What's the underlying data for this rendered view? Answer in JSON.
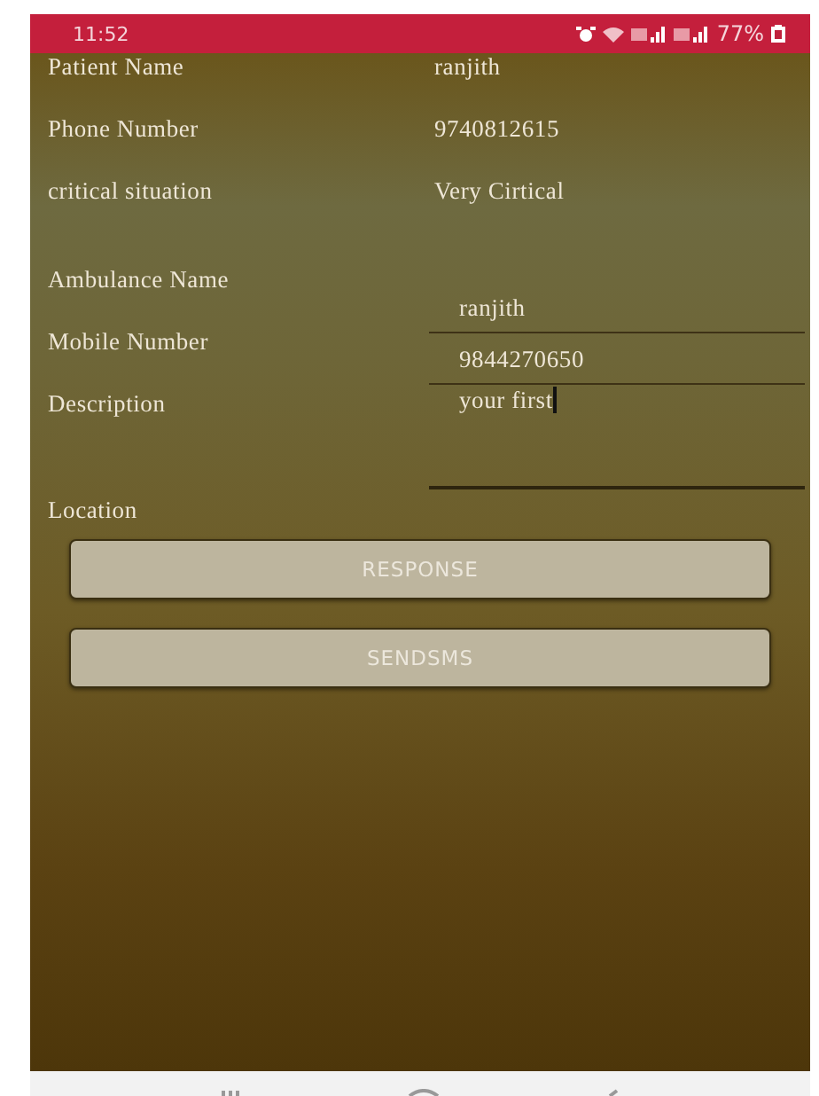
{
  "status_bar": {
    "time": "11:52",
    "battery": "77%"
  },
  "rows": [
    {
      "kind": "text",
      "label": "Patient  Name",
      "value": "ranjith"
    },
    {
      "kind": "text",
      "label": "Phone Number",
      "value": "9740812615"
    },
    {
      "kind": "text",
      "label": "critical situation",
      "value": "Very Cirtical"
    },
    {
      "kind": "field",
      "label": "Ambulance  Name",
      "value": "ranjith",
      "focused": false
    },
    {
      "kind": "field",
      "label": "Mobile Number",
      "value": "9844270650",
      "focused": false
    },
    {
      "kind": "area",
      "label": "Description",
      "value": "your first",
      "focused": true
    },
    {
      "kind": "label",
      "label": "Location"
    }
  ],
  "buttons": [
    "RESPONSE",
    "SENDSMS"
  ]
}
